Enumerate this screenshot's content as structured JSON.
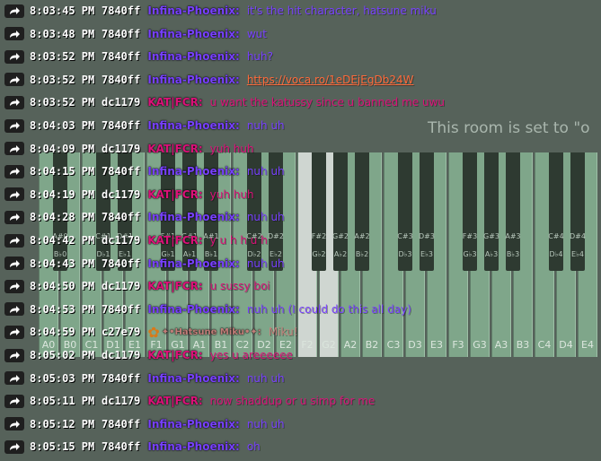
{
  "room_notice": "This room is set to \"o",
  "piano": {
    "white_keys": [
      "A0",
      "B0",
      "C1",
      "D1",
      "E1",
      "F1",
      "G1",
      "A1",
      "B1",
      "C2",
      "D2",
      "E2",
      "F2",
      "G2",
      "A2",
      "B2",
      "C3",
      "D3",
      "E3",
      "F3",
      "G3",
      "A3",
      "B3",
      "C4",
      "D4",
      "E4"
    ],
    "black_keys": [
      "A#0",
      "C#1",
      "D#1",
      "F#1",
      "G#1",
      "A#1",
      "C#2",
      "D#2",
      "F#2",
      "G#2",
      "A#2",
      "C#3",
      "D#3",
      "F#3",
      "G#3",
      "A#3",
      "C#4",
      "D#4"
    ],
    "black_key_flats": [
      "B♭0",
      "D♭1",
      "E♭1",
      "G♭1",
      "A♭1",
      "B♭1",
      "D♭2",
      "E♭2",
      "G♭2",
      "A♭2",
      "B♭2",
      "D♭3",
      "E♭3",
      "G♭3",
      "A♭3",
      "B♭3",
      "D♭4",
      "E♭4"
    ]
  },
  "colors": {
    "phoenix": "#7840ff",
    "kat": "#dc1179",
    "miku": "#c27e79",
    "link": "#ff6a3a"
  },
  "messages": [
    {
      "time": "8:03:45 PM",
      "id": "7840ff",
      "name": "Infina-Phoenix:",
      "text": "it's the hit character, hatsune miku",
      "who": "phoenix"
    },
    {
      "time": "8:03:48 PM",
      "id": "7840ff",
      "name": "Infina-Phoenix:",
      "text": "wut",
      "who": "phoenix"
    },
    {
      "time": "8:03:52 PM",
      "id": "7840ff",
      "name": "Infina-Phoenix:",
      "text": "huh?",
      "who": "phoenix"
    },
    {
      "time": "8:03:52 PM",
      "id": "7840ff",
      "name": "Infina-Phoenix:",
      "text": "https://voca.ro/1eDEjEgDb24W",
      "who": "phoenix",
      "link": true
    },
    {
      "time": "8:03:52 PM",
      "id": "dc1179",
      "name": "KAT|FCR:",
      "text": "u want the katussy since u banned me uwu",
      "who": "kat"
    },
    {
      "time": "8:04:03 PM",
      "id": "7840ff",
      "name": "Infina-Phoenix:",
      "text": "nuh uh",
      "who": "phoenix"
    },
    {
      "time": "8:04:09 PM",
      "id": "dc1179",
      "name": "KAT|FCR:",
      "text": "yuh huh",
      "who": "kat"
    },
    {
      "time": "8:04:15 PM",
      "id": "7840ff",
      "name": "Infina-Phoenix:",
      "text": "nuh uh",
      "who": "phoenix"
    },
    {
      "time": "8:04:19 PM",
      "id": "dc1179",
      "name": "KAT|FCR:",
      "text": "yuh huh",
      "who": "kat"
    },
    {
      "time": "8:04:28 PM",
      "id": "7840ff",
      "name": "Infina-Phoenix:",
      "text": "nuh uh",
      "who": "phoenix"
    },
    {
      "time": "8:04:42 PM",
      "id": "dc1179",
      "name": "KAT|FCR:",
      "text": "y u h h u h",
      "who": "kat"
    },
    {
      "time": "8:04:43 PM",
      "id": "7840ff",
      "name": "Infina-Phoenix:",
      "text": "nuh uh",
      "who": "phoenix"
    },
    {
      "time": "8:04:50 PM",
      "id": "dc1179",
      "name": "KAT|FCR:",
      "text": "u sussy boi",
      "who": "kat"
    },
    {
      "time": "8:04:53 PM",
      "id": "7840ff",
      "name": "Infina-Phoenix:",
      "text": "nuh uh (I could do this all day)",
      "who": "phoenix"
    },
    {
      "time": "8:04:59 PM",
      "id": "c27e79",
      "name": "✦•Hatsune Miku•✦:",
      "text": "Miku!",
      "who": "miku",
      "deco": "✿"
    },
    {
      "time": "8:05:02 PM",
      "id": "dc1179",
      "name": "KAT|FCR:",
      "text": "yes u areeeeee",
      "who": "kat"
    },
    {
      "time": "8:05:03 PM",
      "id": "7840ff",
      "name": "Infina-Phoenix:",
      "text": "nuh uh",
      "who": "phoenix"
    },
    {
      "time": "8:05:11 PM",
      "id": "dc1179",
      "name": "KAT|FCR:",
      "text": "now shaddup or u simp for me",
      "who": "kat"
    },
    {
      "time": "8:05:12 PM",
      "id": "7840ff",
      "name": "Infina-Phoenix:",
      "text": "nuh uh",
      "who": "phoenix"
    },
    {
      "time": "8:05:15 PM",
      "id": "7840ff",
      "name": "Infina-Phoenix:",
      "text": "oh",
      "who": "phoenix"
    }
  ]
}
